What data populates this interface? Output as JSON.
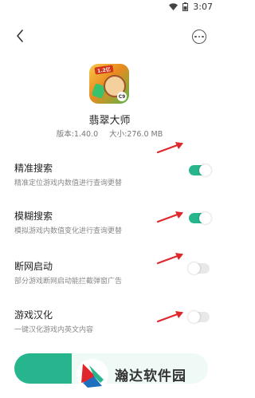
{
  "status_bar": {
    "time": "3:07"
  },
  "header": {
    "back_icon": "chevron-left-icon",
    "more_icon": "more-circle-icon"
  },
  "app": {
    "name": "翡翠大师",
    "version": "版本:1.40.0",
    "size": "大小:276.0 MB",
    "icon_badge": "1.2亿"
  },
  "settings": [
    {
      "title": "精准搜索",
      "desc": "精准定位游戏内数值进行查询更替",
      "enabled": true
    },
    {
      "title": "模糊搜索",
      "desc": "模拟游戏内数值变化进行查询更替",
      "enabled": true
    },
    {
      "title": "断网启动",
      "desc": "部分游戏断网启动能拦截弹窗广告",
      "enabled": false
    },
    {
      "title": "游戏汉化",
      "desc": "一键汉化游戏内英文内容",
      "enabled": false
    }
  ],
  "watermark": {
    "text": "瀚达软件园"
  },
  "colors": {
    "accent": "#27b58d",
    "arrow": "#e0262b",
    "toggle_off": "#e8e8e8"
  }
}
